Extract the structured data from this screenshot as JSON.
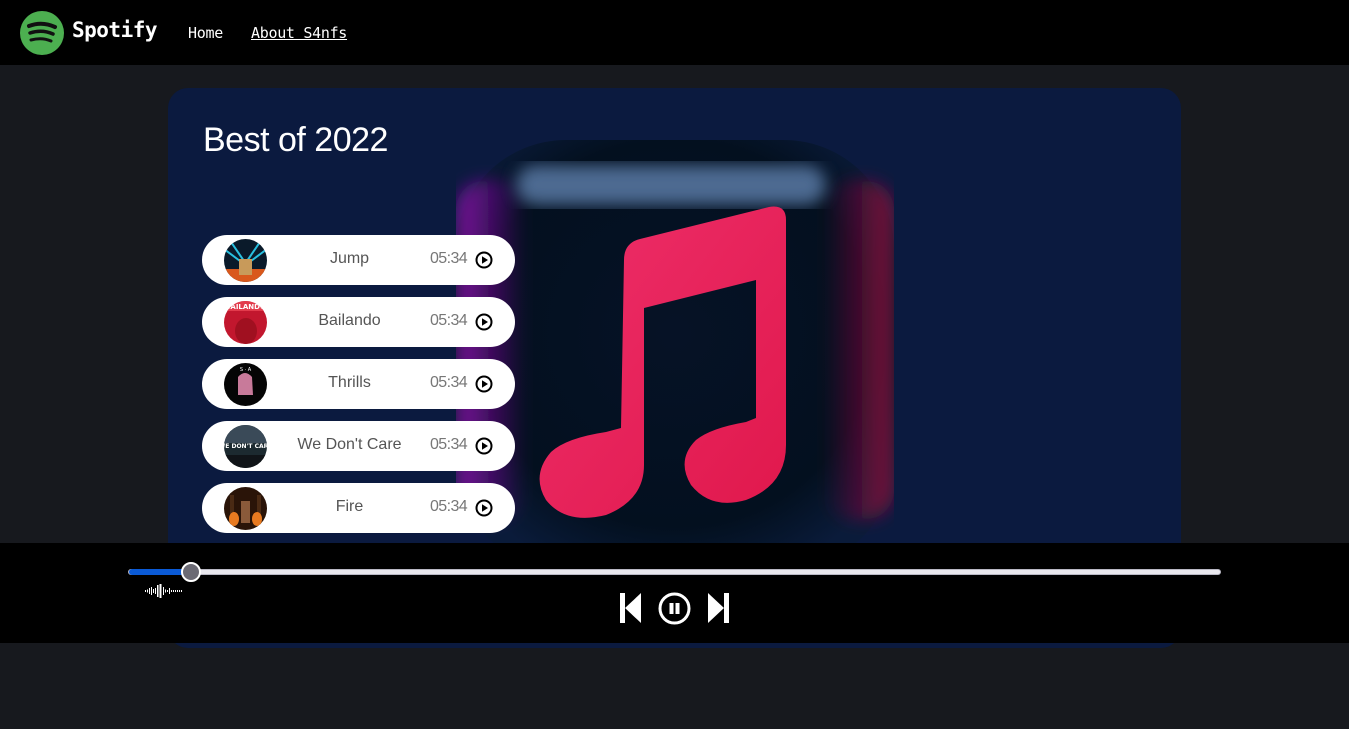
{
  "navbar": {
    "brand": "Spotify",
    "links": [
      {
        "label": "Home"
      },
      {
        "label": "About S4nfs"
      }
    ],
    "brand_color": "#1db954"
  },
  "main": {
    "title": "Best of 2022",
    "art_icon": "music-note-icon",
    "songs": [
      {
        "name": "Jump",
        "duration": "05:34",
        "cover": "jump-cover"
      },
      {
        "name": "Bailando",
        "duration": "05:34",
        "cover": "bailando-cover"
      },
      {
        "name": "Thrills",
        "duration": "05:34",
        "cover": "thrills-cover"
      },
      {
        "name": "We Don't Care",
        "duration": "05:34",
        "cover": "we-dont-care-cover"
      },
      {
        "name": "Fire",
        "duration": "05:34",
        "cover": "fire-cover"
      }
    ]
  },
  "player": {
    "progress_percent": 5.8,
    "accent": "#0a5ad6",
    "playing_indicator": "sound-wave-icon",
    "controls": [
      "previous",
      "pause",
      "next"
    ]
  }
}
